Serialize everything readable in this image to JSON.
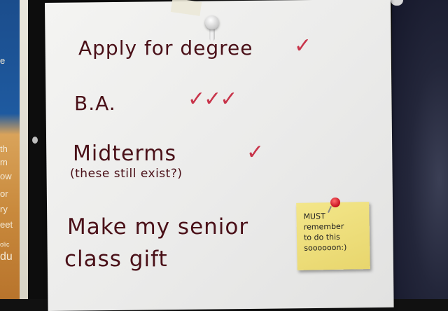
{
  "list": {
    "item1": "Apply for degree",
    "item2": "B.A.",
    "item3": "Midterms",
    "item3_note": "(these still exist?)",
    "item4_line1": "Make my senior",
    "item4_line2": "class gift"
  },
  "checks": {
    "item1": "✓",
    "item2": "✓✓✓",
    "item3": "✓"
  },
  "sticky_note": {
    "line1": "MUST",
    "line2": "remember",
    "line3": "to do this",
    "line4": "soooooon:)"
  },
  "left_poster": {
    "line1": "e",
    "line2": "th",
    "line3": "m",
    "line4": "ow",
    "line5": "or",
    "line6": "ry",
    "line7": "eet",
    "line8": "olic",
    "line9": "du"
  },
  "colors": {
    "ink": "#4a1018",
    "check": "#c8344a",
    "sticky": "#f3e68a"
  }
}
